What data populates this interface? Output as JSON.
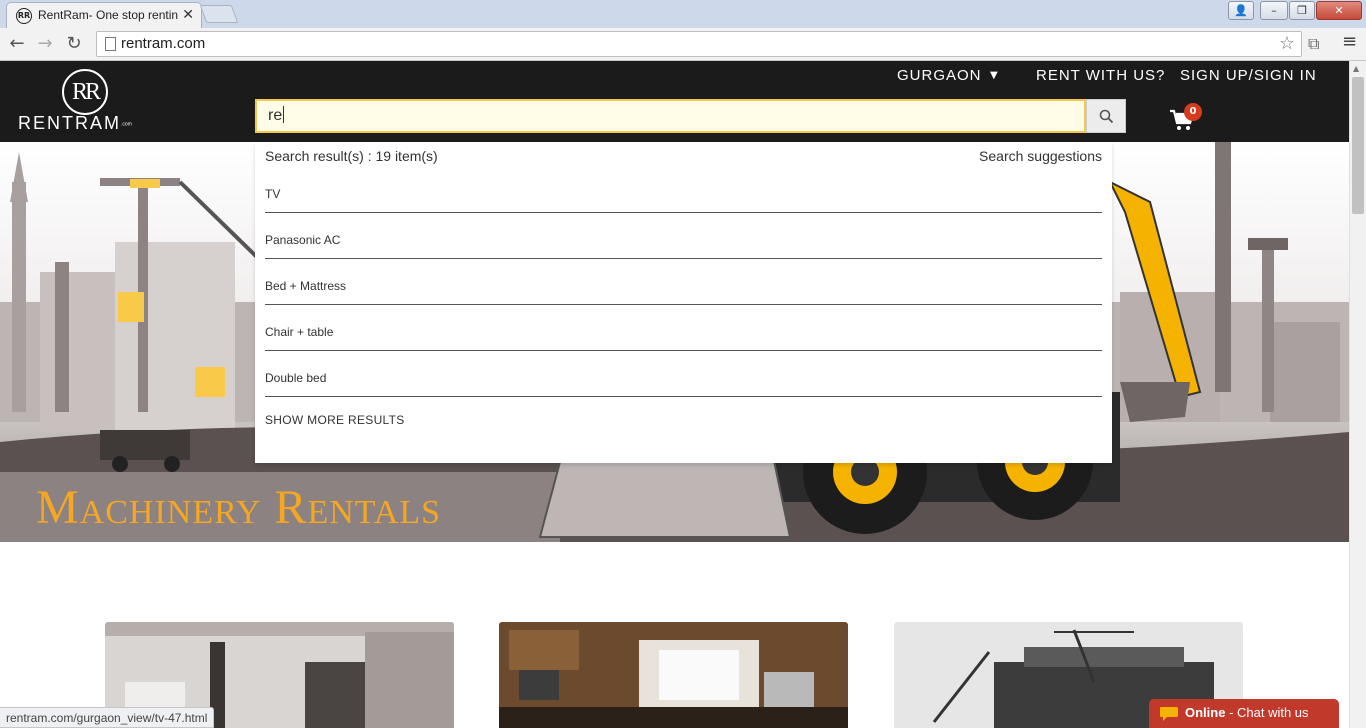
{
  "browser": {
    "tab_title": "RentRam- One stop rentin",
    "url": "rentram.com",
    "status_url": "rentram.com/gurgaon_view/tv-47.html"
  },
  "header": {
    "logo_text": "RENTRAM",
    "logo_suffix": ".com",
    "city": "GURGAON",
    "rent_with_us": "RENT WITH US?",
    "sign_in": "SIGN UP/SIGN IN",
    "cart_count": "0"
  },
  "search": {
    "query": "re",
    "result_count_label": "Search result(s) : 19 item(s)",
    "suggestions_label": "Search suggestions",
    "results": [
      "TV",
      "Panasonic AC",
      "Bed + Mattress",
      "Chair + table",
      "Double bed"
    ],
    "show_more": "SHOW MORE RESULTS"
  },
  "hero": {
    "title": "Machinery Rentals"
  },
  "chat": {
    "status": "Online",
    "label": " - Chat with us"
  },
  "colors": {
    "header_bg": "#1b1b1b",
    "accent_yellow": "#f5a623",
    "chat_red": "#c0392b",
    "badge_red": "#d63b1e"
  }
}
